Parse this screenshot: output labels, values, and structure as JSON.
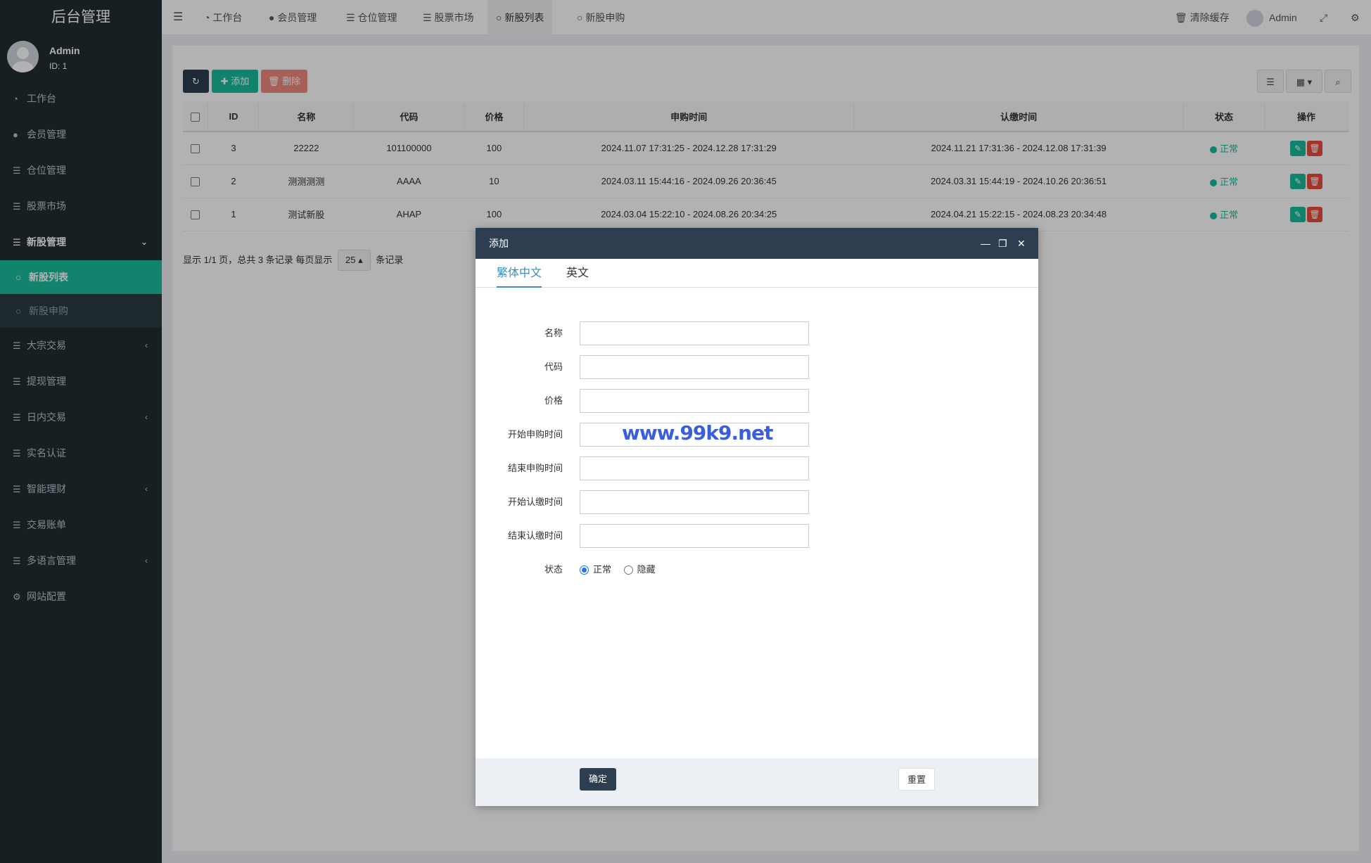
{
  "app": {
    "title": "后台管理"
  },
  "user": {
    "name": "Admin",
    "id": "ID: 1"
  },
  "sidebar": {
    "items": [
      {
        "icon": "dashboard-icon",
        "glyph": "◔",
        "label": "工作台"
      },
      {
        "icon": "user-circle-icon",
        "glyph": "●",
        "label": "会员管理"
      },
      {
        "icon": "list-icon",
        "glyph": "☰",
        "label": "仓位管理"
      },
      {
        "icon": "list-icon",
        "glyph": "☰",
        "label": "股票市场"
      },
      {
        "icon": "list-icon",
        "glyph": "☰",
        "label": "新股管理",
        "arrow": "⌄"
      },
      {
        "icon": "list-icon",
        "glyph": "☰",
        "label": "大宗交易",
        "arrow": "‹"
      },
      {
        "icon": "list-icon",
        "glyph": "☰",
        "label": "提现管理"
      },
      {
        "icon": "list-icon",
        "glyph": "☰",
        "label": "日内交易",
        "arrow": "‹"
      },
      {
        "icon": "list-icon",
        "glyph": "☰",
        "label": "实名认证"
      },
      {
        "icon": "list-icon",
        "glyph": "☰",
        "label": "智能理财",
        "arrow": "‹"
      },
      {
        "icon": "list-icon",
        "glyph": "☰",
        "label": "交易账单"
      },
      {
        "icon": "list-icon",
        "glyph": "☰",
        "label": "多语言管理",
        "arrow": "‹"
      },
      {
        "icon": "gear-icon",
        "glyph": "⚙",
        "label": "网站配置"
      }
    ],
    "sub_items": [
      {
        "label": "新股列表"
      },
      {
        "label": "新股申购"
      }
    ]
  },
  "topbar": {
    "tabs": [
      {
        "glyph": "◔",
        "label": "工作台"
      },
      {
        "glyph": "●",
        "label": "会员管理"
      },
      {
        "glyph": "☰",
        "label": "仓位管理"
      },
      {
        "glyph": "☰",
        "label": "股票市场"
      },
      {
        "glyph": "○",
        "label": "新股列表"
      },
      {
        "glyph": "○",
        "label": "新股申购"
      }
    ],
    "clear_cache": "清除缓存",
    "user": "Admin"
  },
  "toolbar": {
    "add_label": "添加",
    "delete_label": "删除"
  },
  "table": {
    "headers": [
      "ID",
      "名称",
      "代码",
      "价格",
      "申购时间",
      "认缴时间",
      "状态",
      "操作"
    ],
    "rows": [
      {
        "id": "3",
        "name": "22222",
        "code": "101100000",
        "price": "100",
        "subscribe": "2024.11.07 17:31:25 - 2024.12.28 17:31:29",
        "pay": "2024.11.21 17:31:36 - 2024.12.08 17:31:39",
        "status": "正常"
      },
      {
        "id": "2",
        "name": "测测测测",
        "code": "AAAA",
        "price": "10",
        "subscribe": "2024.03.11 15:44:16 - 2024.09.26 20:36:45",
        "pay": "2024.03.31 15:44:19 - 2024.10.26 20:36:51",
        "status": "正常"
      },
      {
        "id": "1",
        "name": "测试新股",
        "code": "AHAP",
        "price": "100",
        "subscribe": "2024.03.04 15:22:10 - 2024.08.26 20:34:25",
        "pay": "2024.04.21 15:22:15 - 2024.08.23 20:34:48",
        "status": "正常"
      }
    ]
  },
  "pagination": {
    "info": "显示 1/1 页，总共 3 条记录  每页显示",
    "page_size": "25",
    "suffix": "条记录"
  },
  "modal": {
    "title": "添加",
    "tabs": [
      "繁体中文",
      "英文"
    ],
    "fields": [
      {
        "label": "名称",
        "value": ""
      },
      {
        "label": "代码",
        "value": ""
      },
      {
        "label": "价格",
        "value": ""
      },
      {
        "label": "开始申购时间",
        "value": ""
      },
      {
        "label": "结束申购时间",
        "value": ""
      },
      {
        "label": "开始认缴时间",
        "value": ""
      },
      {
        "label": "结束认缴时间",
        "value": ""
      }
    ],
    "status_label": "状态",
    "status_options": [
      "正常",
      "隐藏"
    ],
    "status_selected": "正常",
    "watermark": "www.99k9.net",
    "ok_label": "确定",
    "reset_label": "重置"
  },
  "colors": {
    "sidebar": "#222d32",
    "accent": "#18bc9c",
    "primary": "#2c3e50",
    "danger": "#e74c3c",
    "link": "#3c8dbc"
  }
}
